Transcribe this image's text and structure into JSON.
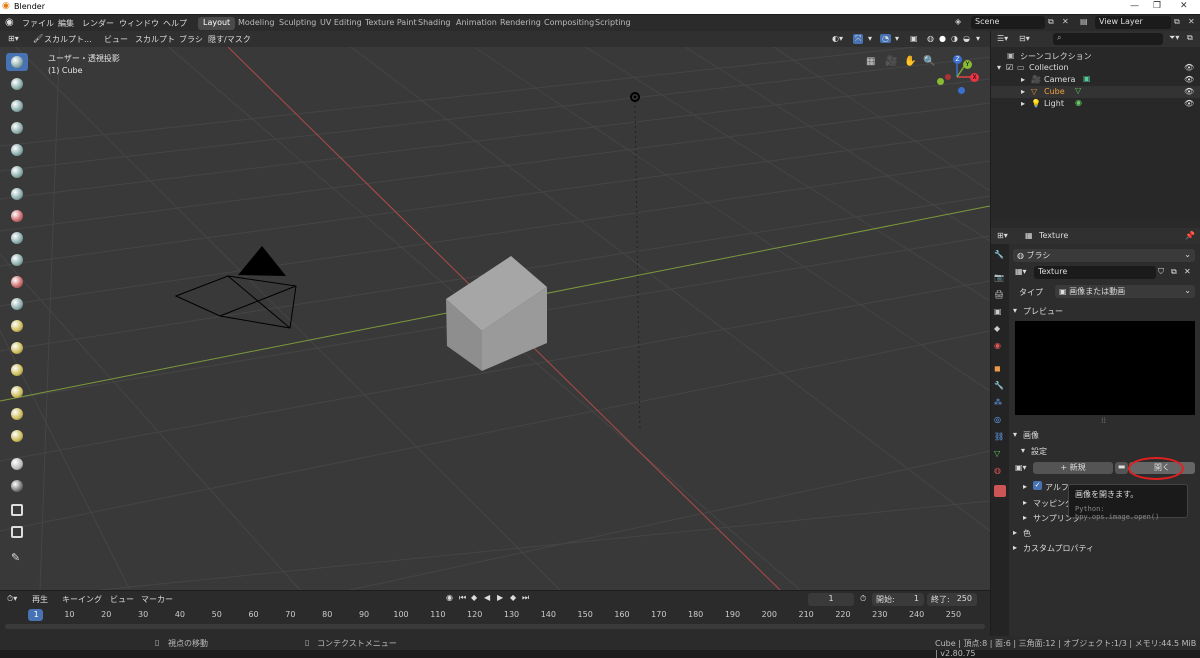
{
  "window": {
    "title": "Blender",
    "controls": [
      "—",
      "❐",
      "✕"
    ]
  },
  "menu": {
    "items": [
      "ファイル",
      "編集",
      "レンダー",
      "ウィンドウ",
      "ヘルプ"
    ]
  },
  "workspaces": [
    "Layout",
    "Modeling",
    "Sculpting",
    "UV Editing",
    "Texture Paint",
    "Shading",
    "Animation",
    "Rendering",
    "Compositing",
    "Scripting"
  ],
  "scene": {
    "label": "Scene"
  },
  "view_layer": {
    "label": "View Layer"
  },
  "viewport": {
    "header": [
      "スカルプト...",
      "ビュー",
      "スカルプト",
      "ブラシ",
      "隠す/マスク"
    ],
    "overlay_title": "ユーザー・透視投影",
    "overlay_object": "(1) Cube",
    "gizmo": {
      "x": "X",
      "y": "Y",
      "z": "Z"
    }
  },
  "outliner": {
    "search_placeholder": "",
    "root": "シーンコレクション",
    "collection": "Collection",
    "items": [
      "Camera",
      "Cube",
      "Light"
    ]
  },
  "properties": {
    "header_title": "Texture",
    "brush_field": "ブラシ",
    "texture_name": "Texture",
    "type_label": "タイプ",
    "type_value": "画像または動画",
    "preview_label": "プレビュー",
    "image_label": "画像",
    "settings_label": "設定",
    "new_button": "新規",
    "open_button": "開く",
    "alpha_label": "アルフ",
    "mapping_label": "マッピング",
    "sampling_label": "サンプリング",
    "color_label": "色",
    "custom_props_label": "カスタムプロパティ"
  },
  "tooltip": {
    "title": "画像を開きます。",
    "python": "Python: bpy.ops.image.open()"
  },
  "timeline": {
    "menus": [
      "再生",
      "キーイング",
      "ビュー",
      "マーカー"
    ],
    "current_frame": "1",
    "start_label": "開始:",
    "start": "1",
    "end_label": "終了:",
    "end": "250",
    "ticks": [
      "1",
      "10",
      "20",
      "30",
      "40",
      "50",
      "60",
      "70",
      "80",
      "90",
      "100",
      "110",
      "120",
      "130",
      "140",
      "150",
      "160",
      "170",
      "180",
      "190",
      "200",
      "210",
      "220",
      "230",
      "240",
      "250"
    ]
  },
  "status": {
    "left1": "視点の移動",
    "left2": "コンテクストメニュー",
    "right": "Cube | 頂点:8 | 面:6 | 三角面:12 | オブジェクト:1/3 | メモリ:44.5 MiB | v2.80.75"
  },
  "colors": {
    "accent": "#4772b3",
    "active_object": "#f0a040",
    "highlight_circle": "#e02020"
  }
}
